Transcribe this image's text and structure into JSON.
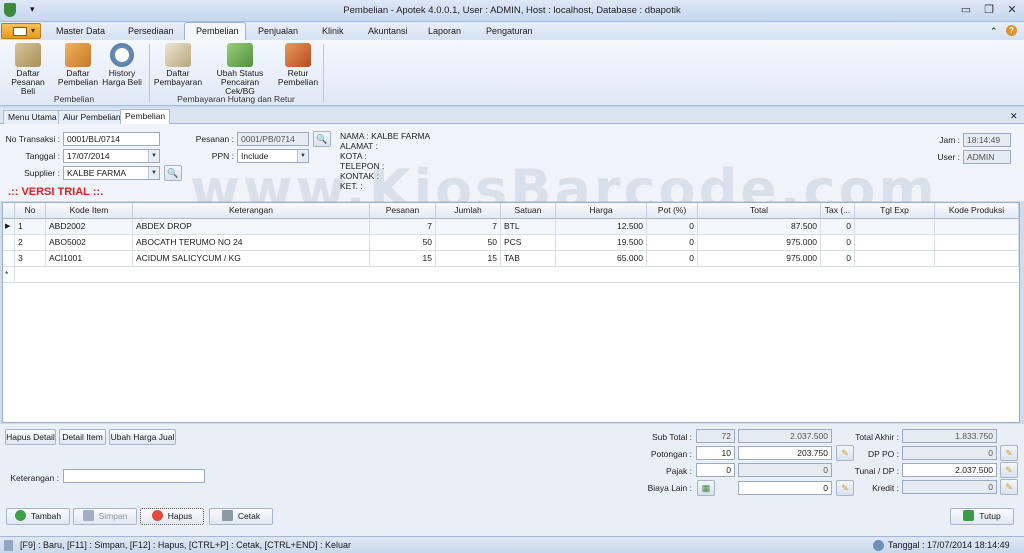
{
  "window": {
    "title": "Pembelian - Apotek 4.0.0.1,  User : ADMIN, Host : localhost, Database : dbapotik"
  },
  "menu": {
    "items": [
      "Master Data",
      "Persediaan",
      "Pembelian",
      "Penjualan",
      "Klinik",
      "Akuntansi",
      "Laporan",
      "Pengaturan"
    ],
    "active": "Pembelian"
  },
  "ribbon": {
    "group1": {
      "label": "Pembelian",
      "buttons": [
        {
          "label1": "Daftar",
          "label2": "Pesanan Beli",
          "icon": "clipboard-pen-icon"
        },
        {
          "label1": "Daftar",
          "label2": "Pembelian",
          "icon": "boxes-icon"
        },
        {
          "label1": "History",
          "label2": "Harga Beli",
          "icon": "clock-icon"
        }
      ]
    },
    "group2": {
      "label": "Pembayaran Hutang dan Retur",
      "buttons": [
        {
          "label1": "Daftar",
          "label2": "Pembayaran",
          "icon": "document-pen-icon"
        },
        {
          "label1": "Ubah Status",
          "label2": "Pencairan Cek/BG",
          "icon": "money-icon"
        },
        {
          "label1": "Retur",
          "label2": "Pembelian",
          "icon": "box-return-icon"
        }
      ]
    }
  },
  "doc_tabs": [
    "Menu Utama",
    "Alur Pembelian",
    "Pembelian"
  ],
  "form": {
    "no_transaksi_label": "No Transaksi :",
    "no_transaksi": "0001/BL/0714",
    "tanggal_label": "Tanggal :",
    "tanggal": "17/07/2014",
    "supplier_label": "Supplier :",
    "supplier": "KALBE FARMA",
    "pesanan_label": "Pesanan :",
    "pesanan": "0001/PB/0714",
    "ppn_label": "PPN :",
    "ppn": "Include",
    "info": {
      "nama": "NAMA : KALBE FARMA",
      "alamat": "ALAMAT :",
      "kota": "KOTA :",
      "telepon": "TELEPON :",
      "kontak": "KONTAK :",
      "ket": "KET. :"
    },
    "jam_label": "Jam :",
    "jam": "18:14:49",
    "user_label": "User :",
    "user": "ADMIN",
    "trial_text": ".:: VERSI TRIAL ::.",
    "watermark": "www.KiosBarcode.com"
  },
  "grid": {
    "columns": [
      "No",
      "Kode Item",
      "Keterangan",
      "Pesanan",
      "Jumlah",
      "Satuan",
      "Harga",
      "Pot (%)",
      "Total",
      "Tax (...",
      "Tgl Exp",
      "Kode Produksi"
    ],
    "rows": [
      {
        "no": "1",
        "kode": "ABD2002",
        "keterangan": "ABDEX DROP",
        "pesanan": "7",
        "jumlah": "7",
        "satuan": "BTL",
        "harga": "12.500",
        "pot": "0",
        "total": "87.500",
        "tax": "0",
        "tgl": "",
        "kode_prod": ""
      },
      {
        "no": "2",
        "kode": "ABO5002",
        "keterangan": "ABOCATH TERUMO NO 24",
        "pesanan": "50",
        "jumlah": "50",
        "satuan": "PCS",
        "harga": "19.500",
        "pot": "0",
        "total": "975.000",
        "tax": "0",
        "tgl": "",
        "kode_prod": ""
      },
      {
        "no": "3",
        "kode": "ACI1001",
        "keterangan": "ACIDUM SALICYCUM / KG",
        "pesanan": "15",
        "jumlah": "15",
        "satuan": "TAB",
        "harga": "65.000",
        "pot": "0",
        "total": "975.000",
        "tax": "0",
        "tgl": "",
        "kode_prod": ""
      }
    ]
  },
  "actions": {
    "hapus_detail": "Hapus Detail",
    "detail_item": "Detail Item",
    "ubah_harga": "Ubah Harga Jual",
    "keterangan_label": "Keterangan :",
    "keterangan": "",
    "tambah": "Tambah",
    "simpan": "Simpan",
    "hapus": "Hapus",
    "cetak": "Cetak",
    "tutup": "Tutup"
  },
  "totals": {
    "sub_total_label": "Sub Total :",
    "sub_total_qty": "72",
    "sub_total": "2.037.500",
    "potongan_label": "Potongan :",
    "potongan_pct": "10",
    "potongan": "203.750",
    "pajak_label": "Pajak :",
    "pajak_pct": "0",
    "pajak": "0",
    "biaya_lain_label": "Biaya Lain :",
    "biaya_lain": "0",
    "total_akhir_label": "Total Akhir :",
    "total_akhir": "1.833.750",
    "dp_po_label": "DP PO :",
    "dp_po": "0",
    "tunai_label": "Tunai / DP :",
    "tunai": "2.037.500",
    "kredit_label": "Kredit :",
    "kredit": "0"
  },
  "status": {
    "shortcuts": "[F9] : Baru, [F11] : Simpan, [F12] : Hapus, [CTRL+P] : Cetak, [CTRL+END] : Keluar",
    "datetime": "Tanggal : 17/07/2014  18:14:49"
  }
}
